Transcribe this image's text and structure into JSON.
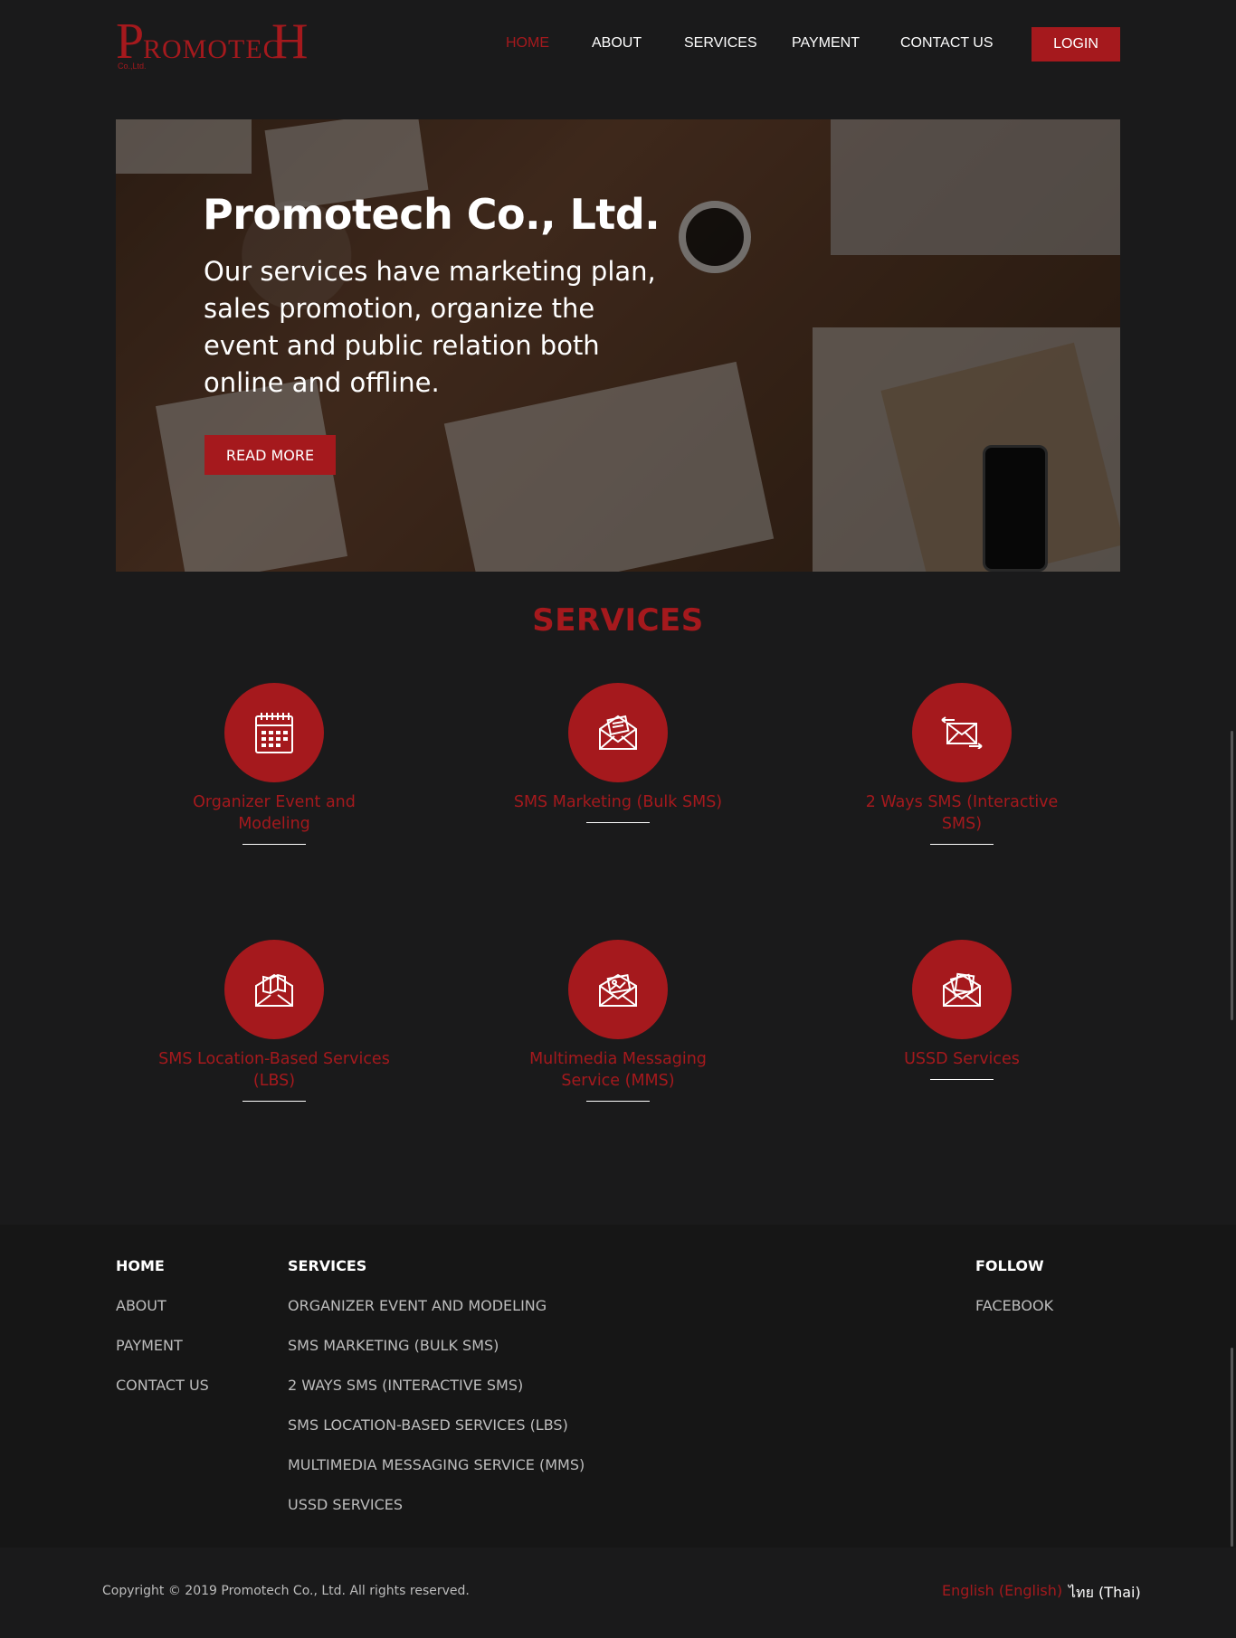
{
  "brand": {
    "logo_letter_p": "P",
    "logo_middle": "ROMOTEC",
    "logo_letter_h": "H",
    "logo_sub": "Co.,Ltd."
  },
  "nav": {
    "home": "HOME",
    "about": "ABOUT",
    "services": "SERVICES",
    "payment": "PAYMENT",
    "contact": "CONTACT US",
    "login": "LOGIN",
    "active_color": "#a5191d"
  },
  "hero": {
    "title": "Promotech Co., Ltd.",
    "text": "Our services have marketing plan, sales promotion, organize the event and public relation both online and offline.",
    "button": "READ MORE"
  },
  "services": {
    "title": "SERVICES",
    "items": [
      {
        "label": "Organizer Event and Modeling",
        "icon": "calendar-icon"
      },
      {
        "label": "SMS Marketing (Bulk SMS)",
        "icon": "envelope-letter-icon"
      },
      {
        "label": "2 Ways SMS (Interactive SMS)",
        "icon": "envelope-arrows-icon"
      },
      {
        "label": "SMS Location-Based Services (LBS)",
        "icon": "envelope-map-icon"
      },
      {
        "label": "Multimedia Messaging Service (MMS)",
        "icon": "envelope-image-icon"
      },
      {
        "label": "USSD Services",
        "icon": "envelope-open-icon"
      }
    ]
  },
  "footer": {
    "col1": {
      "heading": "HOME",
      "links": [
        "ABOUT",
        "PAYMENT",
        "CONTACT US"
      ]
    },
    "col2": {
      "heading": "SERVICES",
      "links": [
        "ORGANIZER EVENT AND MODELING",
        "SMS MARKETING (BULK SMS)",
        "2 WAYS SMS (INTERACTIVE SMS)",
        "SMS LOCATION-BASED SERVICES (LBS)",
        "MULTIMEDIA MESSAGING SERVICE (MMS)",
        "USSD SERVICES"
      ]
    },
    "col3": {
      "heading": "FOLLOW",
      "links": [
        "FACEBOOK"
      ]
    },
    "copyright": "Copyright © 2019 Promotech Co., Ltd. All rights reserved.",
    "lang_en": "English (English)",
    "lang_th": "ไทย (Thai)"
  },
  "colors": {
    "accent": "#a5191d",
    "background": "#1a1a1b",
    "footer_bg": "#161616"
  }
}
